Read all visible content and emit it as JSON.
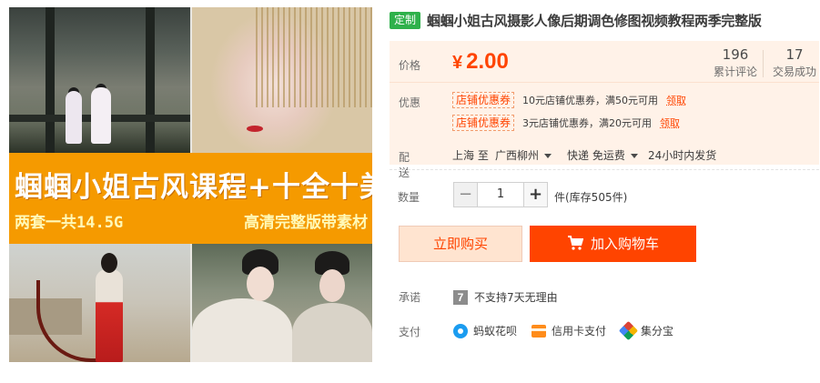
{
  "product_image": {
    "banner_title": "蝈蝈小姐古风课程+十全十美",
    "banner_sub_left": "两套一共14.5G",
    "banner_sub_right": "高清完整版带素材"
  },
  "title": {
    "tag": "定制",
    "text": "蝈蝈小姐古风摄影人像后期调色修图视频教程两季完整版"
  },
  "price": {
    "label": "价格",
    "currency": "¥",
    "amount": "2.00",
    "reviews_count": "196",
    "reviews_label": "累计评论",
    "sales_count": "17",
    "sales_label": "交易成功",
    "color": "#ff4400"
  },
  "promotion": {
    "label": "优惠",
    "coupons": [
      {
        "tag": "店铺优惠券",
        "text": "10元店铺优惠券，满50元可用",
        "link": "领取"
      },
      {
        "tag": "店铺优惠券",
        "text": "3元店铺优惠券，满20元可用",
        "link": "领取"
      }
    ]
  },
  "shipping": {
    "label": "配送",
    "from": "上海 至",
    "to": "广西柳州",
    "method": "快递 免运费",
    "time": "24小时内发货"
  },
  "quantity": {
    "label": "数量",
    "minus": "−",
    "value": "1",
    "plus": "+",
    "stock_text": "件(库存505件)"
  },
  "actions": {
    "buy_now": "立即购买",
    "add_to_cart": "加入购物车"
  },
  "promise": {
    "label": "承诺",
    "icon_text": "7",
    "text": "不支持7天无理由"
  },
  "payment": {
    "label": "支付",
    "methods": [
      {
        "icon": "huabei-icon",
        "text": "蚂蚁花呗"
      },
      {
        "icon": "credit-card-icon",
        "text": "信用卡支付"
      },
      {
        "icon": "jifenbao-icon",
        "text": "集分宝"
      }
    ]
  },
  "colors": {
    "accent": "#ff4400",
    "tag_green": "#2fb14b",
    "price_bg": "#fff2e8",
    "banner_orange": "#f59a00"
  }
}
